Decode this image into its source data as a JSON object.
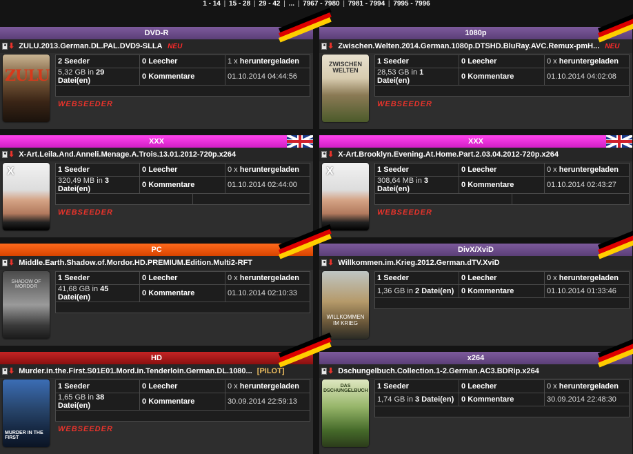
{
  "pagination": [
    "1 - 14",
    "15 - 28",
    "29 - 42",
    "...",
    "7967 - 7980",
    "7981 - 7994",
    "7995 - 7996"
  ],
  "labels": {
    "seeder": "Seeder",
    "leecher": "Leecher",
    "downloaded": "heruntergeladen",
    "comments": "Kommentare",
    "files_in": "in",
    "files_word": "Datei(en)",
    "neu": "NEU",
    "webseeder": "WEBSEEDER"
  },
  "torrents": [
    {
      "category": "DVD-R",
      "category_color": "#6b4a8a",
      "flag": "de",
      "title": "ZULU.2013.German.DL.PAL.DVD9-SLLA",
      "neu": true,
      "seeders": "2",
      "leechers": "0",
      "downloads": "1 x",
      "size": "5,32 GB",
      "files": "29",
      "comments": "0",
      "date": "01.10.2014 04:44:56",
      "webseeder": true,
      "cover_text": "ZULU"
    },
    {
      "category": "1080p",
      "category_color": "#6b4a8a",
      "flag": "de",
      "title": "Zwischen.Welten.2014.German.1080p.DTSHD.BluRay.AVC.Remux-pmH...",
      "neu": true,
      "seeders": "1",
      "leechers": "0",
      "downloads": "0 x",
      "size": "28,53 GB",
      "files": "1",
      "comments": "0",
      "date": "01.10.2014 04:02:08",
      "webseeder": true,
      "cover_text": "ZWISCHEN WELTEN"
    },
    {
      "category": "XXX",
      "category_color": "#ff33ee",
      "flag": "uk",
      "title": "X-Art.Leila.And.Anneli.Menage.A.Trois.13.01.2012-720p.x264",
      "neu": false,
      "seeders": "1",
      "leechers": "0",
      "downloads": "0 x",
      "size": "320,49 MB",
      "files": "3",
      "comments": "0",
      "date": "01.10.2014 02:44:00",
      "webseeder": true,
      "cover_text": "X"
    },
    {
      "category": "XXX",
      "category_color": "#ff33ee",
      "flag": "uk",
      "title": "X-Art.Brooklyn.Evening.At.Home.Part.2.03.04.2012-720p.x264",
      "neu": false,
      "seeders": "1",
      "leechers": "0",
      "downloads": "0 x",
      "size": "308,64 MB",
      "files": "3",
      "comments": "0",
      "date": "01.10.2014 02:43:27",
      "webseeder": true,
      "cover_text": "X"
    },
    {
      "category": "PC",
      "category_color": "#ff5a10",
      "flag": "de",
      "title": "Middle.Earth.Shadow.of.Mordor.HD.PREMIUM.Edition.Multi2-RFT",
      "neu": false,
      "seeders": "1",
      "leechers": "0",
      "downloads": "0 x",
      "size": "41,68 GB",
      "files": "45",
      "comments": "0",
      "date": "01.10.2014 02:10:33",
      "webseeder": false,
      "cover_text": "SHADOW OF MORDOR"
    },
    {
      "category": "DivX/XviD",
      "category_color": "#6b4a8a",
      "flag": "de",
      "title": "Willkommen.im.Krieg.2012.German.dTV.XviD",
      "neu": false,
      "seeders": "1",
      "leechers": "0",
      "downloads": "0 x",
      "size": "1,36 GB",
      "files": "2",
      "comments": "0",
      "date": "01.10.2014 01:33:46",
      "webseeder": false,
      "cover_text": "WILLKOMMEN IM KRIEG"
    },
    {
      "category": "HD",
      "category_color": "#a81a1a",
      "flag": "de",
      "title": "Murder.in.the.First.S01E01.Mord.in.Tenderloin.German.DL.1080...",
      "pilot": "[PILOT]",
      "neu": false,
      "seeders": "1",
      "leechers": "0",
      "downloads": "0 x",
      "size": "1,65 GB",
      "files": "38",
      "comments": "0",
      "date": "30.09.2014 22:59:13",
      "webseeder": true,
      "cover_text": "MURDER IN THE FIRST"
    },
    {
      "category": "x264",
      "category_color": "#6b4a8a",
      "flag": "de",
      "title": "Dschungelbuch.Collection.1-2.German.AC3.BDRip.x264",
      "neu": false,
      "seeders": "1",
      "leechers": "0",
      "downloads": "0 x",
      "size": "1,74 GB",
      "files": "3",
      "comments": "0",
      "date": "30.09.2014 22:48:30",
      "webseeder": false,
      "cover_text": "DAS DSCHUNGELBUCH"
    }
  ]
}
